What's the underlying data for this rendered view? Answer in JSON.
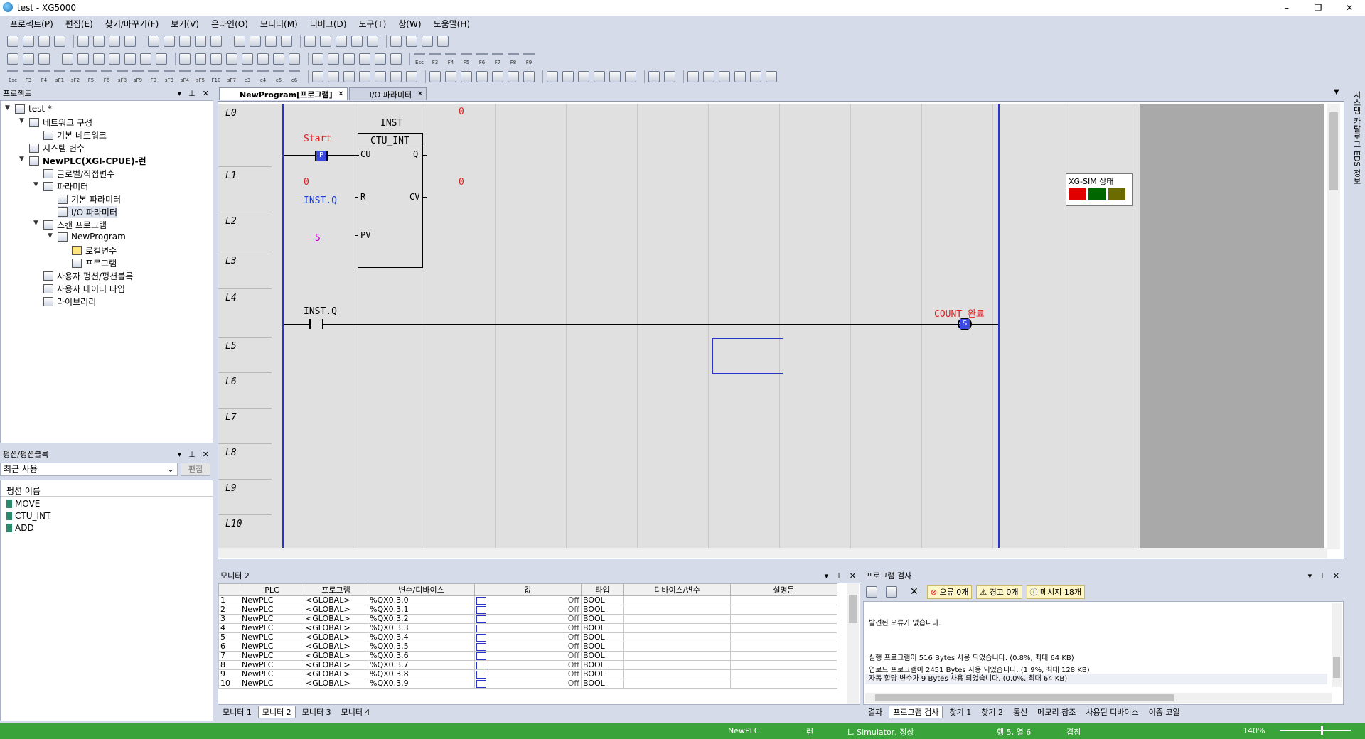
{
  "window": {
    "title": "test - XG5000",
    "min": "–",
    "restore": "❐",
    "close": "✕"
  },
  "menu": [
    "프로젝트(P)",
    "편집(E)",
    "찾기/바꾸기(F)",
    "보기(V)",
    "온라인(O)",
    "모니터(M)",
    "디버그(D)",
    "도구(T)",
    "창(W)",
    "도움말(H)"
  ],
  "toolbar3_keys": [
    "Esc",
    "F3",
    "F4",
    "sF1",
    "sF2",
    "F5",
    "F6",
    "sF8",
    "sF9",
    "F9",
    "sF3",
    "sF4",
    "sF5",
    "F10",
    "sF7",
    "c3",
    "c4",
    "c5",
    "c6"
  ],
  "toolbar2_keys": [
    "Esc",
    "F3",
    "F4",
    "F5",
    "F6",
    "F7",
    "F8",
    "F9"
  ],
  "project_panel": {
    "title": "프로젝트",
    "items": [
      "test *",
      "네트워크 구성",
      "기본 네트워크",
      "시스템 변수",
      "NewPLC(XGI-CPUE)-런",
      "글로벌/직접변수",
      "파라미터",
      "기본 파라미터",
      "I/O 파라미터",
      "스캔 프로그램",
      "NewProgram",
      "로컬변수",
      "프로그램",
      "사용자 펑션/펑션블록",
      "사용자 데이터 타입",
      "라이브러리"
    ]
  },
  "func_panel": {
    "title": "펑션/펑션블록",
    "dropdown": "최근 사용",
    "edit_button": "편집",
    "list_header": "펑션 이름",
    "items": [
      "MOVE",
      "CTU_INT",
      "ADD"
    ]
  },
  "editor": {
    "tabs": [
      "NewProgram[프로그램]",
      "I/O 파라미터"
    ],
    "rows": [
      "L0",
      "L1",
      "L2",
      "L3",
      "L4",
      "L5",
      "L6",
      "L7",
      "L8",
      "L9",
      "L10"
    ],
    "fb_instance": "INST",
    "fb_type": "CTU_INT",
    "fb_val_top": "0",
    "fb_val_cv": "0",
    "pins": {
      "cu": "CU",
      "r": "R",
      "pv": "PV",
      "q": "Q",
      "cv": "CV"
    },
    "contact_start": "Start",
    "start_val": "0",
    "reset_var": "INST.Q",
    "pv_val": "5",
    "contact2": "INST.Q",
    "coil_name": "COUNT_완료",
    "p_mark": "P",
    "s_mark": "S"
  },
  "xgsim": {
    "title": "XG-SIM 상태",
    "colors": [
      "#e00000",
      "#006600",
      "#6b6b00"
    ]
  },
  "right_sidebar": "시스템 카탈로그  EDS 정보",
  "monitor": {
    "title": "모니터 2",
    "columns": [
      "",
      "PLC",
      "프로그램",
      "변수/디바이스",
      "값",
      "타입",
      "디바이스/변수",
      "설명문"
    ],
    "rows": [
      [
        "1",
        "NewPLC",
        "<GLOBAL>",
        "%QX0.3.0",
        "Off",
        "BOOL"
      ],
      [
        "2",
        "NewPLC",
        "<GLOBAL>",
        "%QX0.3.1",
        "Off",
        "BOOL"
      ],
      [
        "3",
        "NewPLC",
        "<GLOBAL>",
        "%QX0.3.2",
        "Off",
        "BOOL"
      ],
      [
        "4",
        "NewPLC",
        "<GLOBAL>",
        "%QX0.3.3",
        "Off",
        "BOOL"
      ],
      [
        "5",
        "NewPLC",
        "<GLOBAL>",
        "%QX0.3.4",
        "Off",
        "BOOL"
      ],
      [
        "6",
        "NewPLC",
        "<GLOBAL>",
        "%QX0.3.5",
        "Off",
        "BOOL"
      ],
      [
        "7",
        "NewPLC",
        "<GLOBAL>",
        "%QX0.3.6",
        "Off",
        "BOOL"
      ],
      [
        "8",
        "NewPLC",
        "<GLOBAL>",
        "%QX0.3.7",
        "Off",
        "BOOL"
      ],
      [
        "9",
        "NewPLC",
        "<GLOBAL>",
        "%QX0.3.8",
        "Off",
        "BOOL"
      ],
      [
        "10",
        "NewPLC",
        "<GLOBAL>",
        "%QX0.3.9",
        "Off",
        "BOOL"
      ]
    ],
    "tabs": [
      "모니터 1",
      "모니터 2",
      "모니터 3",
      "모니터 4"
    ]
  },
  "check": {
    "title": "프로그램 검사",
    "errors": "오류 0개",
    "warnings": "경고 0개",
    "messages": "메시지 18개",
    "line1": "발견된 오류가 없습니다.",
    "line2": "실행 프로그램이 516 Bytes 사용 되었습니다. (0.8%, 최대 64 KB)",
    "line3": "업로드 프로그램이 2451 Bytes 사용 되었습니다. (1.9%, 최대 128 KB)",
    "line4": "자동 할당 변수가 9 Bytes 사용 되었습니다. (0.0%, 최대 64 KB)",
    "tabs": [
      "결과",
      "프로그램 검사",
      "찾기 1",
      "찾기 2",
      "통신",
      "메모리 참조",
      "사용된 디바이스",
      "이중 코일"
    ]
  },
  "status": {
    "plc": "NewPLC",
    "mode": "런",
    "sim": "L, Simulator, 정상",
    "pos": "행 5, 열 6",
    "overwrite": "겹침",
    "zoom": "140%"
  }
}
